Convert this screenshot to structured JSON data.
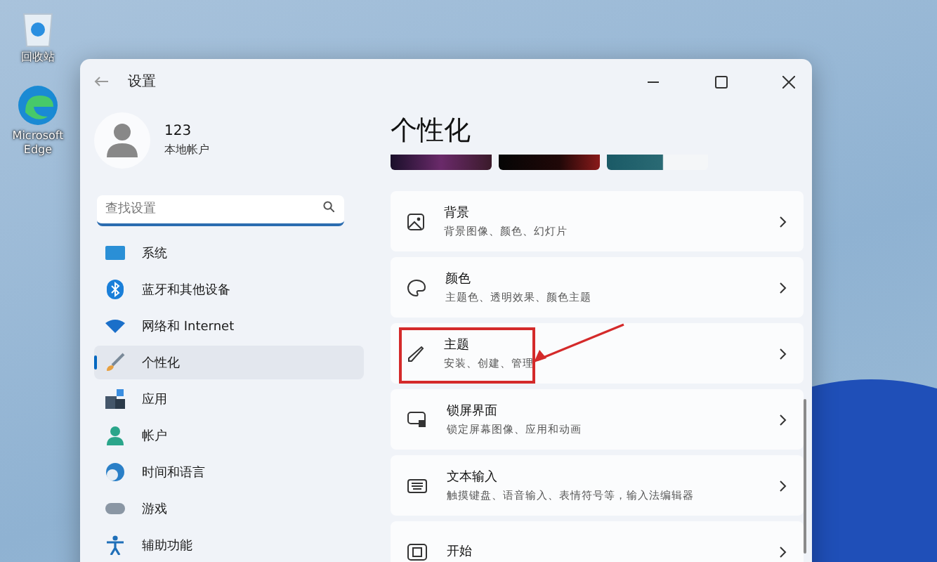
{
  "desktop_icons": [
    {
      "kind": "recycle",
      "label": "回收站"
    },
    {
      "kind": "edge",
      "label": "Microsoft Edge"
    }
  ],
  "window": {
    "title": "设置"
  },
  "profile": {
    "name": "123",
    "account_type": "本地帐户"
  },
  "search": {
    "placeholder": "查找设置"
  },
  "sidebar": {
    "items": [
      {
        "label": "系统",
        "selected": false
      },
      {
        "label": "蓝牙和其他设备",
        "selected": false
      },
      {
        "label": "网络和 Internet",
        "selected": false
      },
      {
        "label": "个性化",
        "selected": true
      },
      {
        "label": "应用",
        "selected": false
      },
      {
        "label": "帐户",
        "selected": false
      },
      {
        "label": "时间和语言",
        "selected": false
      },
      {
        "label": "游戏",
        "selected": false
      },
      {
        "label": "辅助功能",
        "selected": false
      }
    ]
  },
  "page": {
    "title": "个性化",
    "settings": [
      {
        "title": "背景",
        "subtitle": "背景图像、颜色、幻灯片",
        "annotated": false
      },
      {
        "title": "颜色",
        "subtitle": "主题色、透明效果、颜色主题",
        "annotated": false
      },
      {
        "title": "主题",
        "subtitle": "安装、创建、管理",
        "annotated": true
      },
      {
        "title": "锁屏界面",
        "subtitle": "锁定屏幕图像、应用和动画",
        "annotated": false
      },
      {
        "title": "文本输入",
        "subtitle": "触摸键盘、语音输入、表情符号等，输入法编辑器",
        "annotated": false
      },
      {
        "title": "开始",
        "annotated": false
      }
    ]
  }
}
